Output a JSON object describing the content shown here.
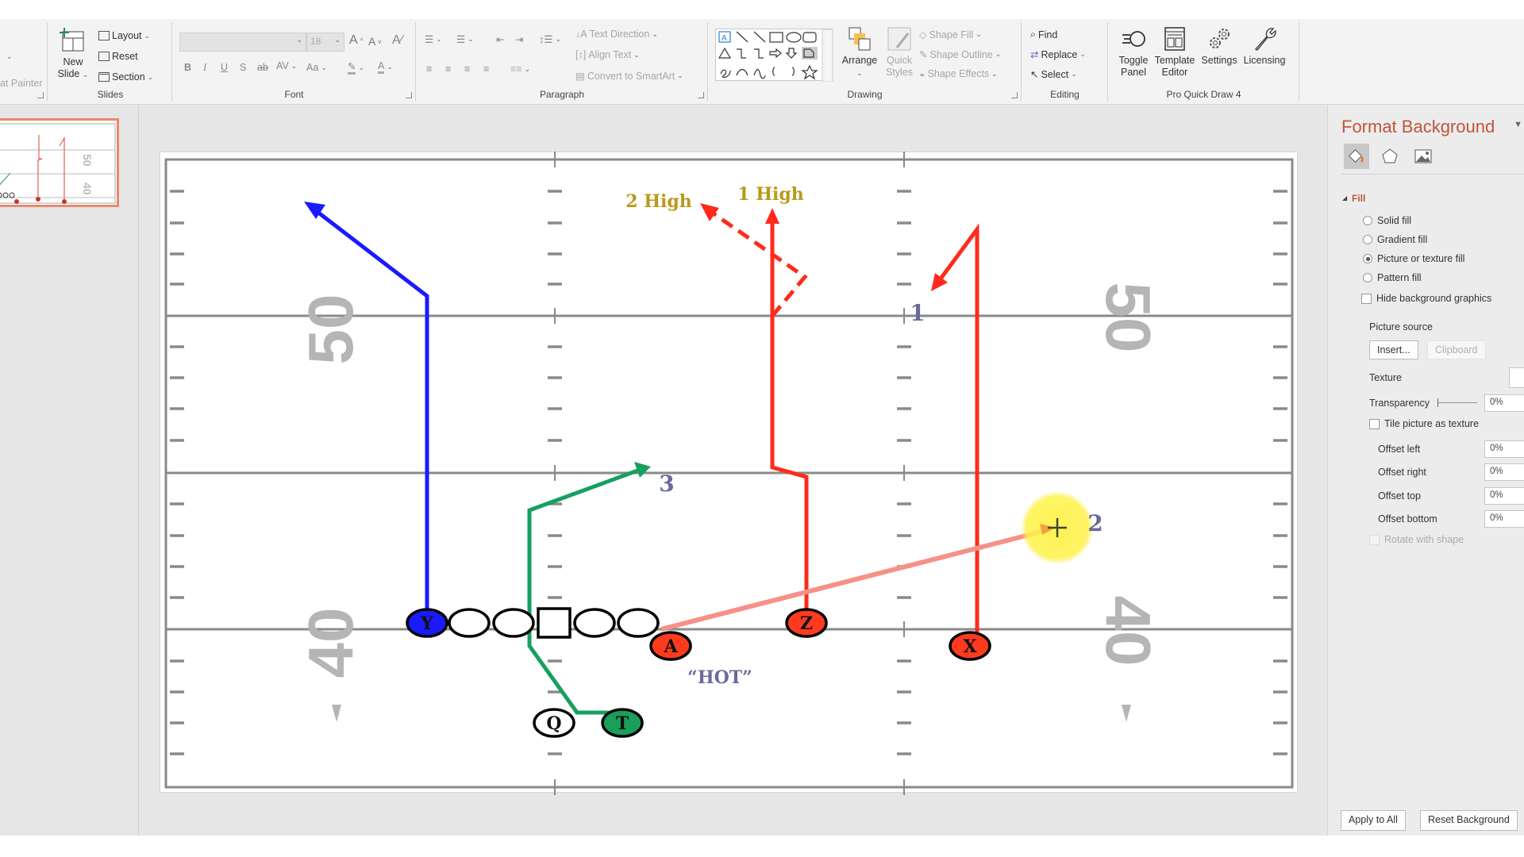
{
  "ribbon": {
    "clipboard": {
      "format_painter": "at Painter"
    },
    "slides": {
      "group_label": "Slides",
      "new_slide": [
        "New",
        "Slide"
      ],
      "layout": "Layout",
      "reset": "Reset",
      "section": "Section"
    },
    "font": {
      "group_label": "Font",
      "font_name": "",
      "font_size": "18",
      "bold": "B",
      "italic": "I",
      "underline": "U",
      "shadow": "S",
      "strike": "ab",
      "spacing": "AV",
      "case": "Aa",
      "grow": "A",
      "shrink": "A"
    },
    "paragraph": {
      "group_label": "Paragraph",
      "text_direction": "Text Direction",
      "align_text": "Align Text",
      "convert_smartart": "Convert to SmartArt"
    },
    "drawing": {
      "group_label": "Drawing",
      "arrange": "Arrange",
      "quick_styles": [
        "Quick",
        "Styles"
      ],
      "shape_fill": "Shape Fill",
      "shape_outline": "Shape Outline",
      "shape_effects": "Shape Effects"
    },
    "editing": {
      "group_label": "Editing",
      "find": "Find",
      "replace": "Replace",
      "select": "Select"
    },
    "pro_quick_draw": {
      "group_label": "Pro Quick Draw 4",
      "toggle_panel": [
        "Toggle",
        "Panel"
      ],
      "template_editor": [
        "Template",
        "Editor"
      ],
      "settings": "Settings",
      "licensing": "Licensing"
    }
  },
  "slide": {
    "yard_numbers": {
      "left_top": "50",
      "left_bottom": "40",
      "right_top": "50",
      "right_bottom": "40"
    },
    "players": [
      {
        "id": "Y",
        "label": "Y",
        "color": "#1a1aff"
      },
      {
        "id": "A",
        "label": "A",
        "color": "#ff3b1f"
      },
      {
        "id": "Z",
        "label": "Z",
        "color": "#ff3b1f"
      },
      {
        "id": "X",
        "label": "X",
        "color": "#ff3b1f"
      },
      {
        "id": "Q",
        "label": "Q",
        "color": "#ffffff"
      },
      {
        "id": "T",
        "label": "T",
        "color": "#1a9e5c"
      }
    ],
    "linemen_count": 5,
    "labels": {
      "two_high": "2 High",
      "one_high": "1 High",
      "read_1": "1",
      "read_2": "2",
      "read_3": "3",
      "hot": "“HOT”"
    },
    "colors": {
      "route_blue": "#1a1aff",
      "route_red": "#ff2a1a",
      "route_green": "#16a060",
      "route_hot": "#f79088",
      "label_gold": "#b89a1a",
      "label_slate": "#6a6a9e",
      "field_line": "#8a8a8a",
      "yard_number": "#b5b5b5",
      "cursor_highlight": "#fff24a"
    }
  },
  "panel": {
    "title": "Format Background",
    "section": "Fill",
    "fill_options": [
      {
        "label": "Solid fill",
        "selected": false
      },
      {
        "label": "Gradient fill",
        "selected": false
      },
      {
        "label": "Picture or texture fill",
        "selected": true
      },
      {
        "label": "Pattern fill",
        "selected": false
      }
    ],
    "hide_background_graphics": "Hide background graphics",
    "picture_source": "Picture source",
    "insert": "Insert...",
    "clipboard": "Clipboard",
    "texture": "Texture",
    "transparency": "Transparency",
    "transparency_value": "0%",
    "tile_picture": "Tile picture as texture",
    "offsets": [
      {
        "label": "Offset left",
        "value": "0%"
      },
      {
        "label": "Offset right",
        "value": "0%"
      },
      {
        "label": "Offset top",
        "value": "0%"
      },
      {
        "label": "Offset bottom",
        "value": "0%"
      }
    ],
    "rotate_with_shape": "Rotate with shape",
    "apply_to_all": "Apply to All",
    "reset_background": "Reset Background"
  }
}
